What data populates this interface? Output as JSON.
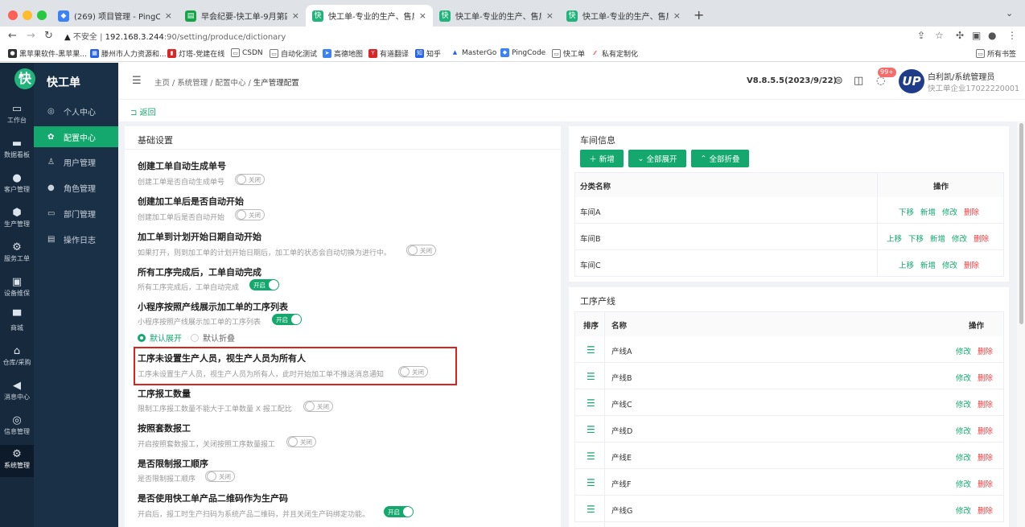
{
  "browser": {
    "tabs": [
      {
        "title": "(269) 项目管理 - PingCode",
        "icon_color": "#3b82f6",
        "icon": "pingcode-icon"
      },
      {
        "title": "早会纪要-快工单-9月第四周",
        "icon_color": "#16a34a",
        "icon": "doc-icon"
      },
      {
        "title": "快工单-专业的生产、售后、维修",
        "icon_color": "#21b47a",
        "icon": "kgd-icon"
      },
      {
        "title": "快工单-专业的生产、售后、维修",
        "icon_color": "#21b47a",
        "icon": "kgd-icon"
      },
      {
        "title": "快工单-专业的生产、售后、维修",
        "icon_color": "#21b47a",
        "icon": "kgd-icon"
      }
    ],
    "address": {
      "insecure": "不安全",
      "host": "192.168.3.244",
      "path": ":90/setting/produce/dictionary"
    },
    "bookmarks": [
      "黑苹果软件-黑苹果...",
      "滕州市人力资源和...",
      "灯塔-党建在线",
      "CSDN",
      "自动化测试",
      "高德地图",
      "有道翻译",
      "知乎",
      "MasterGo",
      "PingCode",
      "快工单",
      "私有定制化"
    ],
    "all_bookmarks": "所有书签"
  },
  "app": {
    "logo_char": "快",
    "name": "快工单",
    "left_nav": [
      {
        "label": "工作台",
        "icon": "dashboard-icon"
      },
      {
        "label": "数据看板",
        "icon": "chart-icon"
      },
      {
        "label": "客户管理",
        "icon": "user-icon"
      },
      {
        "label": "生产管理",
        "icon": "box-icon"
      },
      {
        "label": "服务工单",
        "icon": "service-icon"
      },
      {
        "label": "设备维保",
        "icon": "device-icon"
      },
      {
        "label": "商城",
        "icon": "shop-icon"
      },
      {
        "label": "仓库/采购",
        "icon": "warehouse-icon"
      },
      {
        "label": "消息中心",
        "icon": "message-icon"
      },
      {
        "label": "信息管理",
        "icon": "info-icon"
      },
      {
        "label": "系统管理",
        "icon": "settings-icon"
      }
    ],
    "sub_nav": [
      {
        "label": "个人中心",
        "icon": "person-icon"
      },
      {
        "label": "配置中心",
        "icon": "config-icon"
      },
      {
        "label": "用户管理",
        "icon": "users-icon"
      },
      {
        "label": "角色管理",
        "icon": "role-icon"
      },
      {
        "label": "部门管理",
        "icon": "dept-icon"
      },
      {
        "label": "操作日志",
        "icon": "log-icon"
      }
    ],
    "breadcrumb": [
      "主页",
      "系统管理",
      "配置中心",
      "生产管理配置"
    ],
    "version": "V8.8.5.5(2023/9/22)",
    "notify_badge": "99+",
    "avatar_text": "UP",
    "user_name": "白利凯/系统管理员",
    "company": "快工单企业17022220001",
    "back": "返回"
  },
  "basic": {
    "title": "基础设置",
    "settings": [
      {
        "title": "创建工单自动生成单号",
        "desc": "创建工单是否自动生成单号",
        "state": "关闭"
      },
      {
        "title": "创建加工单后是否自动开始",
        "desc": "创建加工单后是否自动开始",
        "state": "关闭"
      },
      {
        "title": "加工单到计划开始日期自动开始",
        "desc": "如果打开，则到加工单的计划开始日期后，加工单的状态会自动切换为进行中。",
        "state": "关闭"
      },
      {
        "title": "所有工序完成后，工单自动完成",
        "desc": "所有工序完成后，工单自动完成",
        "state": "开启"
      },
      {
        "title": "小程序按照产线展示加工单的工序列表",
        "desc": "小程序按照产线展示加工单的工序列表",
        "state": "开启"
      },
      {
        "title": "工序未设置生产人员，视生产人员为所有人",
        "desc": "工序未设置生产人员，视生产人员为所有人，此时开始加工单不推送消息通知",
        "state": "关闭"
      },
      {
        "title": "工序报工数量",
        "desc": "限制工序报工数量不能大于工单数量 X 报工配比",
        "state": "关闭"
      },
      {
        "title": "按照套数报工",
        "desc": "开启按照套数报工，关闭按照工序数量报工",
        "state": "关闭"
      },
      {
        "title": "是否限制报工顺序",
        "desc": "是否限制报工顺序",
        "state": "关闭"
      },
      {
        "title": "是否使用快工单产品二维码作为生产码",
        "desc": "开启后，报工时生产扫码为系统产品二维码，并且关闭生产码绑定功能。",
        "state": "开启"
      }
    ],
    "radio": {
      "selected": "默认展开",
      "other": "默认折叠"
    }
  },
  "workshop": {
    "title": "车间信息",
    "buttons": {
      "add": "新增",
      "expand": "全部展开",
      "collapse": "全部折叠"
    },
    "headers": {
      "name": "分类名称",
      "ops": "操作"
    },
    "rows": [
      {
        "name": "车间A",
        "ops": [
          "下移",
          "新增",
          "修改"
        ],
        "danger": "删除"
      },
      {
        "name": "车间B",
        "ops": [
          "上移",
          "下移",
          "新增",
          "修改"
        ],
        "danger": "删除"
      },
      {
        "name": "车间C",
        "ops": [
          "上移",
          "新增",
          "修改"
        ],
        "danger": "删除"
      }
    ]
  },
  "lines": {
    "title": "工序产线",
    "headers": {
      "order": "排序",
      "name": "名称",
      "ops": "操作"
    },
    "rows": [
      "产线A",
      "产线B",
      "产线C",
      "产线D",
      "产线E",
      "产线F",
      "产线G"
    ],
    "edit": "修改",
    "delete": "删除"
  },
  "colors": {
    "brand": "#14a86e",
    "danger": "#f23c3c",
    "sidebar": "#16293d",
    "highlight": "#d9241e"
  }
}
